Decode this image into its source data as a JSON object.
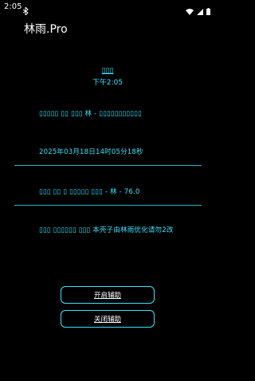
{
  "status_bar": {
    "time": "2:05"
  },
  "app": {
    "title": "林雨.Pro"
  },
  "header": {
    "garbled_label": "▯▯▯",
    "time_label": "下午2:05"
  },
  "info": {
    "line1": "▯▯▯▯▯ ▯▯ ▯▯▯ 林 - ▯▯▯▯▯▯▯▯▯▯▯",
    "line2": "2025年03月18日14时05分18秒",
    "line3": "▯▯▯ ▯▯ ▯ ▯▯▯▯▯ ▯▯▯ - 林 - 76.0",
    "line4": "▯▯▯ ▯▯▯▯▯▯ ▯▯▯ 本壳子由林雨优化请勿2改"
  },
  "buttons": {
    "start_label": "开启辅助",
    "stop_label": "关闭辅助"
  },
  "colors": {
    "accent": "#33e6ff",
    "background": "#000000"
  }
}
